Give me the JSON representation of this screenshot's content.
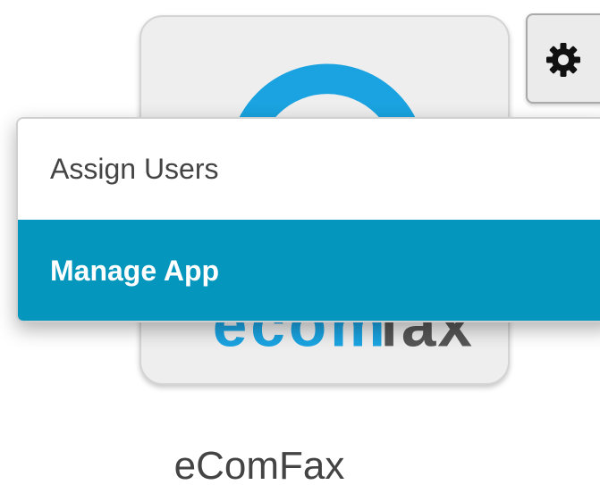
{
  "app": {
    "name": "eComFax",
    "logo_icon": "ecomfax-logo",
    "logo_color": "#1aa3e0"
  },
  "settings_button": {
    "icon": "gear-icon"
  },
  "menu": {
    "items": [
      {
        "label": "Assign Users",
        "active": false
      },
      {
        "label": "Manage App",
        "active": true
      }
    ],
    "highlight_color": "#0596bd"
  }
}
